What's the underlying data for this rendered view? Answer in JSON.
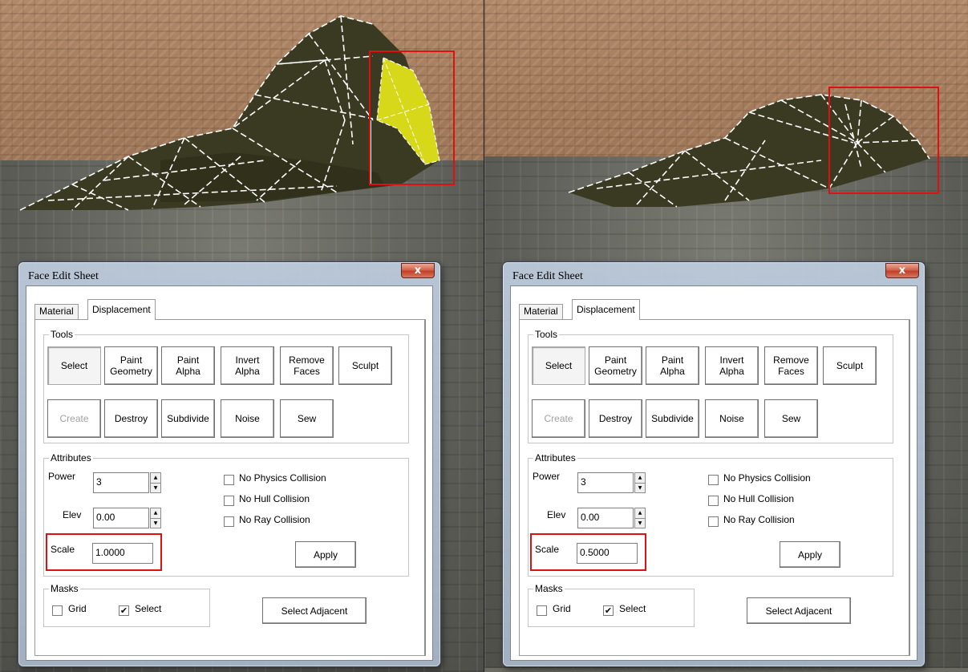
{
  "panels": [
    {
      "dialog": {
        "title": "Face Edit Sheet",
        "close_label": "x",
        "tabs": [
          {
            "label": "Material"
          },
          {
            "label": "Displacement",
            "active": true
          }
        ],
        "tools": {
          "label": "Tools",
          "row1": [
            {
              "label": "Select",
              "state": "pressed"
            },
            {
              "label": "Paint\nGeometry"
            },
            {
              "label": "Paint\nAlpha"
            },
            {
              "label": "Invert\nAlpha"
            },
            {
              "label": "Remove\nFaces"
            },
            {
              "label": "Sculpt"
            }
          ],
          "row2": [
            {
              "label": "Create",
              "state": "disabled"
            },
            {
              "label": "Destroy"
            },
            {
              "label": "Subdivide"
            },
            {
              "label": "Noise"
            },
            {
              "label": "Sew"
            }
          ]
        },
        "attributes": {
          "label": "Attributes",
          "power_label": "Power",
          "power_value": "3",
          "elev_label": "Elev",
          "elev_value": "0.00",
          "scale_label": "Scale",
          "scale_value": "1.0000",
          "no_physics": "No Physics Collision",
          "no_hull": "No Hull Collision",
          "no_ray": "No Ray Collision",
          "apply": "Apply"
        },
        "masks": {
          "label": "Masks",
          "grid": "Grid",
          "grid_checked": false,
          "select": "Select",
          "select_checked": true
        },
        "select_adjacent": "Select Adjacent"
      }
    },
    {
      "dialog": {
        "title": "Face Edit Sheet",
        "close_label": "x",
        "tabs": [
          {
            "label": "Material"
          },
          {
            "label": "Displacement",
            "active": true
          }
        ],
        "tools": {
          "label": "Tools",
          "row1": [
            {
              "label": "Select",
              "state": "pressed"
            },
            {
              "label": "Paint\nGeometry"
            },
            {
              "label": "Paint\nAlpha"
            },
            {
              "label": "Invert\nAlpha"
            },
            {
              "label": "Remove\nFaces"
            },
            {
              "label": "Sculpt"
            }
          ],
          "row2": [
            {
              "label": "Create",
              "state": "disabled"
            },
            {
              "label": "Destroy"
            },
            {
              "label": "Subdivide"
            },
            {
              "label": "Noise"
            },
            {
              "label": "Sew"
            }
          ]
        },
        "attributes": {
          "label": "Attributes",
          "power_label": "Power",
          "power_value": "3",
          "elev_label": "Elev",
          "elev_value": "0.00",
          "scale_label": "Scale",
          "scale_value": "0.5000",
          "no_physics": "No Physics Collision",
          "no_hull": "No Hull Collision",
          "no_ray": "No Ray Collision",
          "apply": "Apply"
        },
        "masks": {
          "label": "Masks",
          "grid": "Grid",
          "grid_checked": false,
          "select": "Select",
          "select_checked": true
        },
        "select_adjacent": "Select Adjacent"
      }
    }
  ],
  "colors": {
    "highlight": "#e01010",
    "selected_face": "#d8d81a"
  }
}
